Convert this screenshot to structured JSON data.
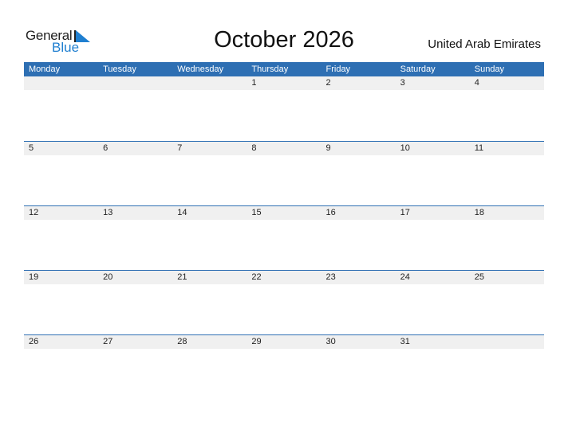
{
  "brand": {
    "general": "General",
    "blue": "Blue"
  },
  "title": "October 2026",
  "country": "United Arab Emirates",
  "weekdays": [
    "Monday",
    "Tuesday",
    "Wednesday",
    "Thursday",
    "Friday",
    "Saturday",
    "Sunday"
  ],
  "weeks": [
    [
      "",
      "",
      "",
      "1",
      "2",
      "3",
      "4"
    ],
    [
      "5",
      "6",
      "7",
      "8",
      "9",
      "10",
      "11"
    ],
    [
      "12",
      "13",
      "14",
      "15",
      "16",
      "17",
      "18"
    ],
    [
      "19",
      "20",
      "21",
      "22",
      "23",
      "24",
      "25"
    ],
    [
      "26",
      "27",
      "28",
      "29",
      "30",
      "31",
      ""
    ]
  ],
  "colors": {
    "header": "#2e6fb3",
    "brand_blue": "#1f7fd0",
    "date_strip": "#f0f0f0"
  }
}
